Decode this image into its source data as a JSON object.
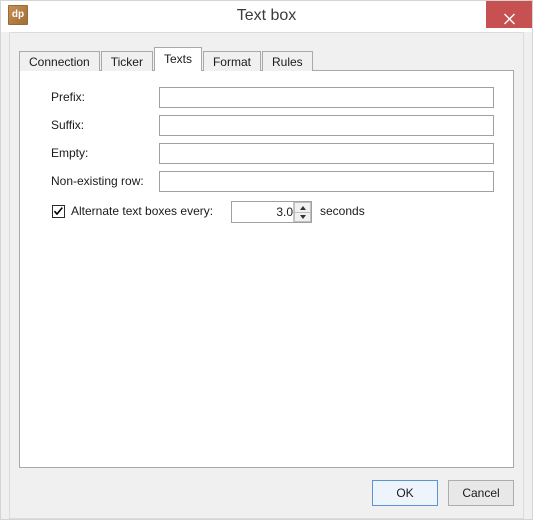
{
  "window": {
    "title": "Text box",
    "icon_label": "dp",
    "icon_name": "dp-app-icon",
    "close_label": "close-icon",
    "close_color": "#c75050"
  },
  "tabs": [
    {
      "label": "Connection",
      "active": false
    },
    {
      "label": "Ticker",
      "active": false
    },
    {
      "label": "Texts",
      "active": true
    },
    {
      "label": "Format",
      "active": false
    },
    {
      "label": "Rules",
      "active": false
    }
  ],
  "form": {
    "fields": [
      {
        "label": "Prefix:",
        "value": "",
        "placeholder": ""
      },
      {
        "label": "Suffix:",
        "value": "",
        "placeholder": ""
      },
      {
        "label": "Empty:",
        "value": "",
        "placeholder": ""
      },
      {
        "label": "Non-existing row:",
        "value": "",
        "placeholder": ""
      }
    ],
    "alternate": {
      "checked": true,
      "label": "Alternate text boxes every:",
      "value": "3.0",
      "units": "seconds"
    }
  },
  "footer": {
    "ok_label": "OK",
    "cancel_label": "Cancel"
  }
}
